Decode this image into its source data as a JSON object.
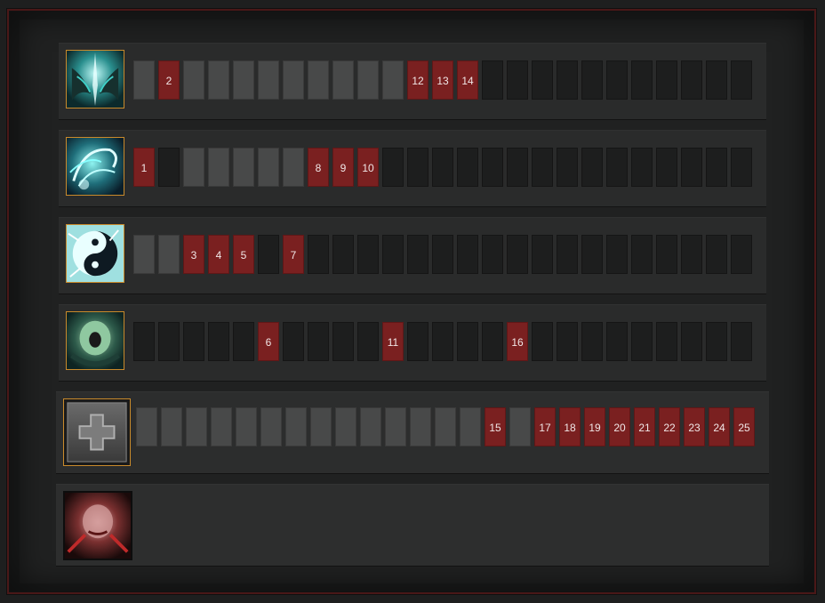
{
  "abilities": [
    {
      "name": "ability-1",
      "icon": "crossed-wings-icon",
      "cells": [
        "used",
        "2",
        "used",
        "used",
        "used",
        "used",
        "used",
        "used",
        "used",
        "used",
        "used",
        "12",
        "13",
        "14",
        "empty",
        "empty",
        "empty",
        "empty",
        "empty",
        "empty",
        "empty",
        "empty",
        "empty",
        "empty",
        "empty"
      ]
    },
    {
      "name": "ability-2",
      "icon": "water-swirl-icon",
      "cells": [
        "1",
        "empty",
        "used",
        "used",
        "used",
        "used",
        "used",
        "8",
        "9",
        "10",
        "empty",
        "empty",
        "empty",
        "empty",
        "empty",
        "empty",
        "empty",
        "empty",
        "empty",
        "empty",
        "empty",
        "empty",
        "empty",
        "empty",
        "empty"
      ]
    },
    {
      "name": "ability-3",
      "icon": "yin-yang-splash-icon",
      "cells": [
        "used",
        "used",
        "3",
        "4",
        "5",
        "empty",
        "7",
        "empty",
        "empty",
        "empty",
        "empty",
        "empty",
        "empty",
        "empty",
        "empty",
        "empty",
        "empty",
        "empty",
        "empty",
        "empty",
        "empty",
        "empty",
        "empty",
        "empty",
        "empty"
      ]
    },
    {
      "name": "ability-4",
      "icon": "screaming-face-icon",
      "cells": [
        "empty",
        "empty",
        "empty",
        "empty",
        "empty",
        "6",
        "empty",
        "empty",
        "empty",
        "empty",
        "11",
        "empty",
        "empty",
        "empty",
        "empty",
        "16",
        "empty",
        "empty",
        "empty",
        "empty",
        "empty",
        "empty",
        "empty",
        "empty",
        "empty"
      ]
    }
  ],
  "talent": {
    "icon": "plus-icon",
    "cells": [
      "used",
      "used",
      "used",
      "used",
      "used",
      "used",
      "used",
      "used",
      "used",
      "used",
      "used",
      "used",
      "used",
      "used",
      "15",
      "used",
      "17",
      "18",
      "19",
      "20",
      "21",
      "22",
      "23",
      "24",
      "25"
    ]
  },
  "ultimate": {
    "icon": "red-face-icon"
  },
  "colors": {
    "level": "#7a2020",
    "used": "#484949",
    "empty": "#1d1e1e",
    "border_gold": "#c98a2b"
  }
}
